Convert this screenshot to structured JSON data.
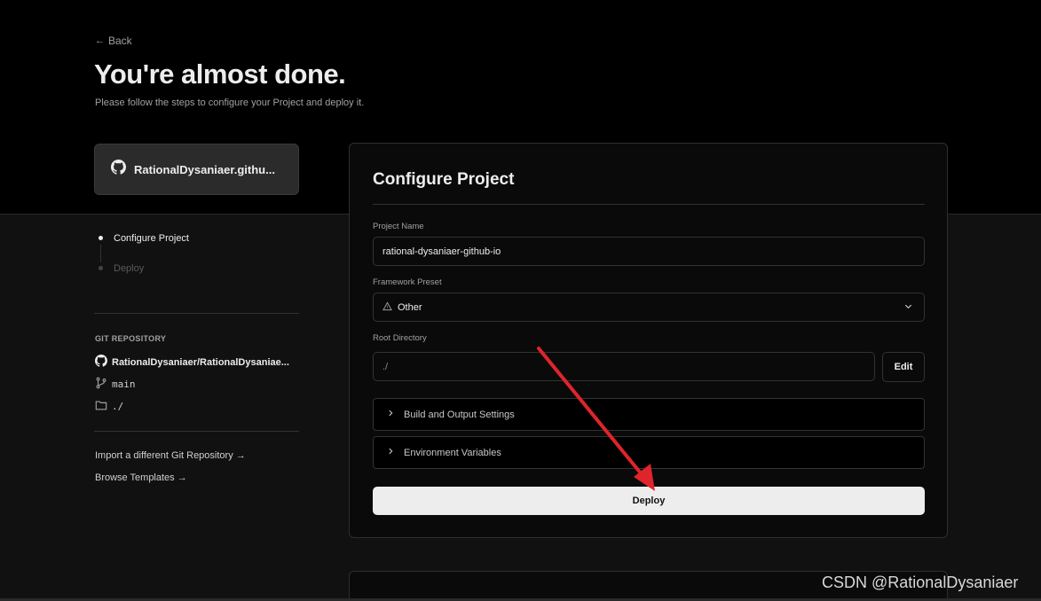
{
  "header": {
    "back_label": "Back",
    "title": "You're almost done.",
    "subtitle": "Please follow the steps to configure your Project and deploy it."
  },
  "repo_card": {
    "label": "RationalDysaniaer.githu..."
  },
  "steps": [
    {
      "label": "Configure Project",
      "state": "active"
    },
    {
      "label": "Deploy",
      "state": "inactive"
    }
  ],
  "git": {
    "heading": "GIT REPOSITORY",
    "repo": "RationalDysaniaer/RationalDysaniae...",
    "branch": "main",
    "directory": "./"
  },
  "links": {
    "import": "Import a different Git Repository →",
    "templates": "Browse Templates →"
  },
  "config": {
    "title": "Configure Project",
    "project_name_label": "Project Name",
    "project_name_value": "rational-dysaniaer-github-io",
    "framework_label": "Framework Preset",
    "framework_value": "Other",
    "root_label": "Root Directory",
    "root_value": "./",
    "edit_label": "Edit",
    "build_settings_label": "Build and Output Settings",
    "env_vars_label": "Environment Variables",
    "deploy_label": "Deploy"
  },
  "watermark": "CSDN @RationalDysaniaer",
  "colors": {
    "background": "#111111",
    "header_band": "#000000",
    "annotation_arrow": "#e0242b",
    "deploy_button": "#ededed"
  },
  "icons": {
    "back": "arrow-left-icon",
    "repo": "github-icon",
    "branch": "git-branch-icon",
    "folder": "folder-icon",
    "framework": "triangle-icon",
    "chevron_down": "chevron-down-icon",
    "chevron_right": "chevron-right-icon"
  }
}
